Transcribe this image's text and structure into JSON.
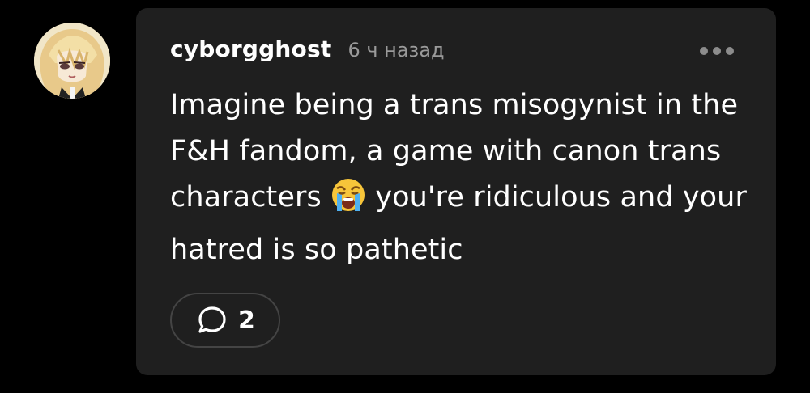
{
  "comment": {
    "username": "cyborgghost",
    "timestamp": "6 ч назад",
    "text_before_emoji": "Imagine being a trans misogynist in the F&H fandom, a game with canon trans characters",
    "emoji": "loudly-crying-face",
    "text_after_emoji": "you're ridiculous and your hatred is so pathetic",
    "reply_count": "2"
  },
  "icons": {
    "more": "more-horizontal-icon",
    "reply": "speech-bubble-icon"
  },
  "colors": {
    "background": "#000000",
    "card": "#1f1f1f",
    "text": "#ffffff",
    "muted": "#9a9a9a"
  }
}
